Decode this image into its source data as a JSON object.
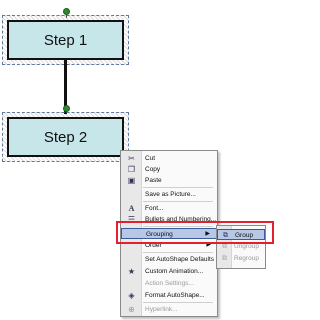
{
  "shapes": {
    "step1": "Step 1",
    "step2": "Step 2"
  },
  "context_menu": {
    "items": [
      {
        "label": "Cut",
        "icon": "scissors-icon",
        "enabled": true
      },
      {
        "label": "Copy",
        "icon": "copy-icon",
        "enabled": true
      },
      {
        "label": "Paste",
        "icon": "paste-icon",
        "enabled": true
      },
      {
        "label": "Save as Picture...",
        "icon": "",
        "enabled": true
      },
      {
        "label": "Font...",
        "icon": "font-icon",
        "enabled": true
      },
      {
        "label": "Bullets and Numbering...",
        "icon": "bullets-icon",
        "enabled": true
      },
      {
        "label": "Grouping",
        "icon": "",
        "enabled": true,
        "submenu": true,
        "highlighted": true
      },
      {
        "label": "Order",
        "icon": "",
        "enabled": true,
        "submenu": true
      },
      {
        "label": "Set AutoShape Defaults",
        "icon": "",
        "enabled": true
      },
      {
        "label": "Custom Animation...",
        "icon": "animation-icon",
        "enabled": true
      },
      {
        "label": "Action Settings...",
        "icon": "",
        "enabled": false
      },
      {
        "label": "Format AutoShape...",
        "icon": "format-icon",
        "enabled": true
      },
      {
        "label": "Hyperlink...",
        "icon": "hyperlink-icon",
        "enabled": false
      }
    ]
  },
  "grouping_submenu": {
    "items": [
      {
        "label": "Group",
        "icon": "group-icon",
        "enabled": true,
        "highlighted": true
      },
      {
        "label": "Ungroup",
        "icon": "ungroup-icon",
        "enabled": false
      },
      {
        "label": "Regroup",
        "icon": "regroup-icon",
        "enabled": false
      }
    ]
  },
  "colors": {
    "shape_fill": "#c7e6ea",
    "highlight": "#b7c7e6",
    "callout": "#e3202e"
  }
}
